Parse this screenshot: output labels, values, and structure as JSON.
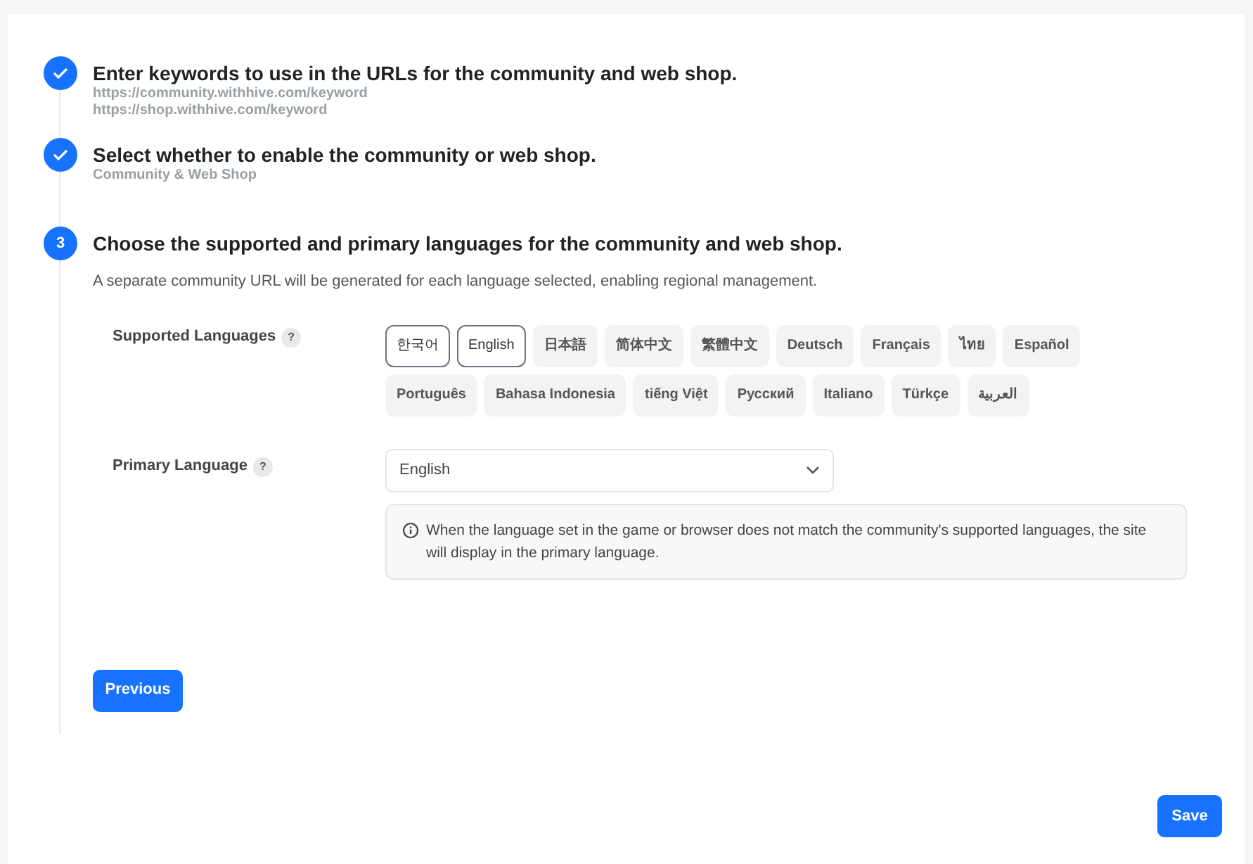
{
  "steps": [
    {
      "kind": "done",
      "title": "Enter keywords to use in the URLs for the community and web shop.",
      "details": [
        "https://community.withhive.com/keyword",
        "https://shop.withhive.com/keyword"
      ]
    },
    {
      "kind": "done",
      "title": "Select whether to enable the community or web shop.",
      "details": [
        "Community & Web Shop"
      ]
    },
    {
      "kind": "current",
      "number": "3",
      "title": "Choose the supported and primary languages for the community and web shop.",
      "description": "A separate community URL will be generated for each language selected, enabling regional management."
    }
  ],
  "supported_languages": {
    "label": "Supported Languages",
    "help": "?",
    "options": [
      {
        "label": "한국어",
        "selected": true
      },
      {
        "label": "English",
        "selected": true
      },
      {
        "label": "日本語",
        "selected": false
      },
      {
        "label": "简体中文",
        "selected": false
      },
      {
        "label": "繁體中文",
        "selected": false
      },
      {
        "label": "Deutsch",
        "selected": false
      },
      {
        "label": "Français",
        "selected": false
      },
      {
        "label": "ไทย",
        "selected": false
      },
      {
        "label": "Español",
        "selected": false
      },
      {
        "label": "Português",
        "selected": false
      },
      {
        "label": "Bahasa Indonesia",
        "selected": false
      },
      {
        "label": "tiếng Việt",
        "selected": false
      },
      {
        "label": "Русский",
        "selected": false
      },
      {
        "label": "Italiano",
        "selected": false
      },
      {
        "label": "Türkçe",
        "selected": false
      },
      {
        "label": "العربية",
        "selected": false
      }
    ]
  },
  "primary_language": {
    "label": "Primary Language",
    "help": "?",
    "value": "English",
    "note": "When the language set in the game or browser does not match the community's supported languages, the site will display in the primary language."
  },
  "previous_button": "Previous",
  "save_button": "Save"
}
